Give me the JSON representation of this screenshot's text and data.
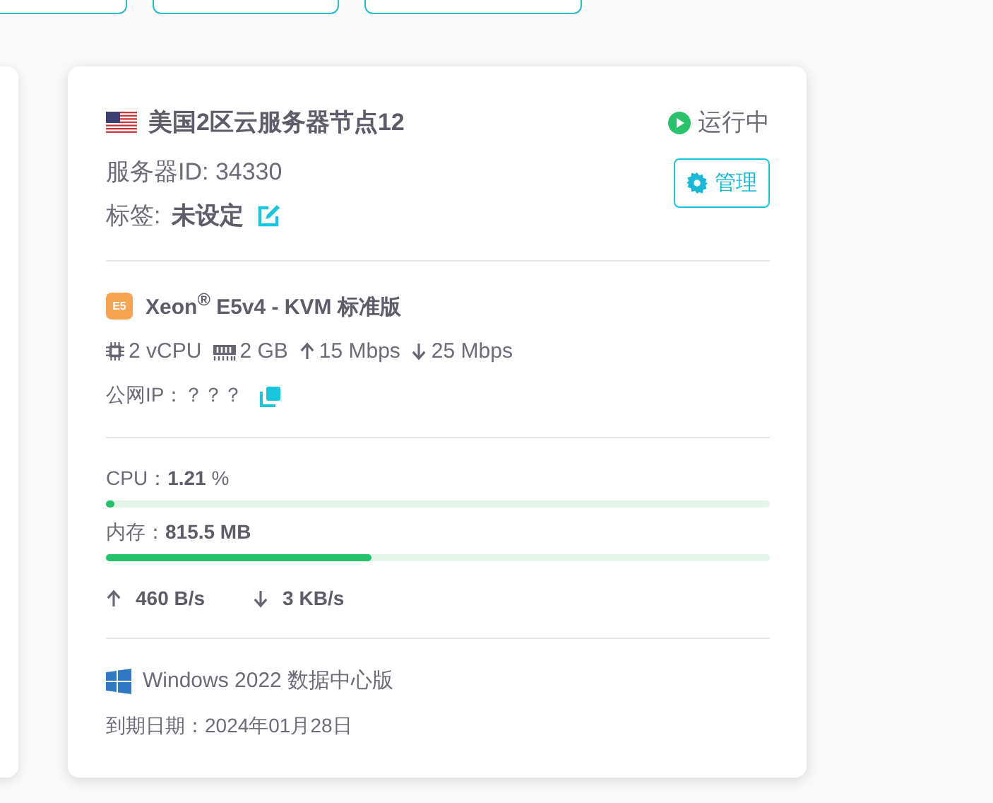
{
  "server": {
    "flag": {
      "kind": "us"
    },
    "title": "美国2区云服务器节点12",
    "status": {
      "kind": "running",
      "label": "运行中"
    },
    "id_text": "服务器ID: 34330",
    "tag_label": "标签:",
    "tag_value": "未设定",
    "manage_button": "管理",
    "cpu_badge": "E5",
    "cpu_model": "Xeon$^{®}$ E5v4 - KVM 标准版",
    "specs": [
      {
        "kind": "cpu",
        "text": "2 vCPU"
      },
      {
        "kind": "ram",
        "text": "2 GB"
      },
      {
        "kind": "up",
        "text": "15 Mbps"
      },
      {
        "kind": "down",
        "text": "25 Mbps"
      }
    ],
    "public_ip": "公网IP：？？？",
    "usage": [
      {
        "text": "CPU：**1.21** %",
        "level": 0.0121
      },
      {
        "text": "内存：**815.5 MB**",
        "level": 0.4
      }
    ],
    "traffic": [
      {
        "kind": "up",
        "text": "460 B/s"
      },
      {
        "kind": "down",
        "text": "3 KB/s"
      }
    ],
    "os": {
      "kind": "windows",
      "name": "Windows 2022 数据中心版"
    },
    "expiry": "到期日期：2024年01月28日"
  }
}
